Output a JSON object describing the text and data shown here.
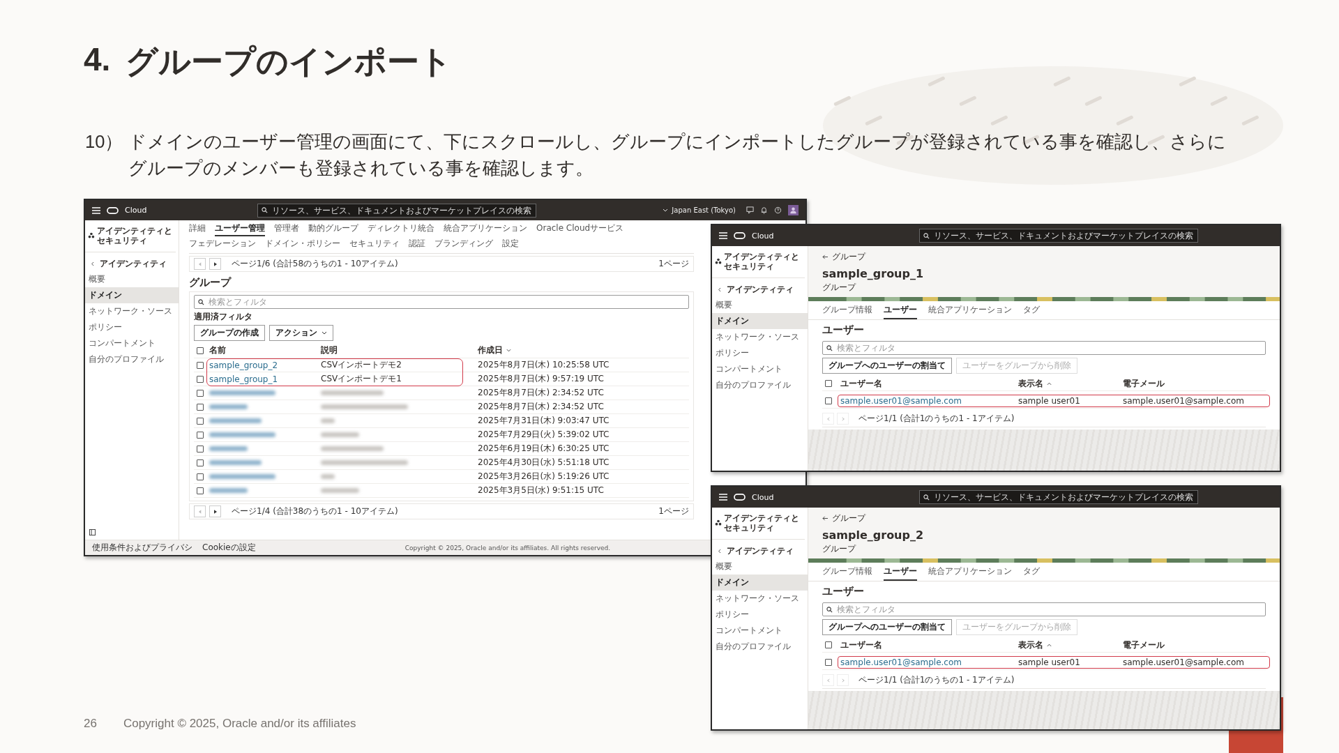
{
  "slide": {
    "title_number": "4.",
    "title": "グループのインポート",
    "step_number": "10）",
    "instruction": "ドメインのユーザー管理の画面にて、下にスクロールし、グループにインポートしたグループが登録されている事を確認し、さらにグループのメンバーも登録されている事を確認します。",
    "page_number": "26",
    "copyright": "Copyright © 2025, Oracle and/or its affiliates"
  },
  "console": {
    "brand": "Cloud",
    "search_placeholder": "リソース、サービス、ドキュメントおよびマーケットプレイスの検索",
    "region": "Japan East (Tokyo)",
    "sidebar": {
      "title": "アイデンティティとセキュリティ",
      "back": "アイデンティティ",
      "items": [
        {
          "label": "概要",
          "selected": false
        },
        {
          "label": "ドメイン",
          "selected": true
        },
        {
          "label": "ネットワーク・ソース",
          "selected": false
        },
        {
          "label": "ポリシー",
          "selected": false
        },
        {
          "label": "コンパートメント",
          "selected": false
        },
        {
          "label": "自分のプロファイル",
          "selected": false
        }
      ]
    },
    "tabs": [
      {
        "label": "詳細",
        "selected": false
      },
      {
        "label": "ユーザー管理",
        "selected": true
      },
      {
        "label": "管理者",
        "selected": false
      },
      {
        "label": "動的グループ",
        "selected": false
      },
      {
        "label": "ディレクトリ統合",
        "selected": false
      },
      {
        "label": "統合アプリケーション",
        "selected": false
      },
      {
        "label": "Oracle Cloudサービス",
        "selected": false
      },
      {
        "label": "フェデレーション",
        "selected": false
      },
      {
        "label": "ドメイン・ポリシー",
        "selected": false
      },
      {
        "label": "セキュリティ",
        "selected": false
      },
      {
        "label": "認証",
        "selected": false
      },
      {
        "label": "ブランディング",
        "selected": false
      },
      {
        "label": "設定",
        "selected": false
      }
    ],
    "pager_top": "ページ1/6 (合計58のうちの1 - 10アイテム)",
    "pager_top_right": "1ページ",
    "heading": "グループ",
    "filter_placeholder": "検索とフィルタ",
    "filter_label": "適用済フィルタ",
    "create_button": "グループの作成",
    "action_menu": "アクション",
    "columns": [
      "名前",
      "説明",
      "作成日"
    ],
    "header_checked": false,
    "rows": [
      {
        "kind": "group",
        "name": "sample_group_2",
        "description": "CSVインポートデモ2",
        "created": "2025年8月7日(木) 10:25:58 UTC",
        "highlighted": true,
        "checked": false
      },
      {
        "kind": "group",
        "name": "sample_group_1",
        "description": "CSVインポートデモ1",
        "created": "2025年8月7日(木) 9:57:19 UTC",
        "highlighted": true,
        "checked": false
      },
      {
        "kind": "blurred",
        "created": "2025年8月7日(木) 2:34:52 UTC",
        "highlighted": false,
        "checked": false
      },
      {
        "kind": "blurred",
        "created": "2025年8月7日(木) 2:34:52 UTC",
        "highlighted": false,
        "checked": false
      },
      {
        "kind": "blurred",
        "created": "2025年7月31日(木) 9:03:47 UTC",
        "highlighted": false,
        "checked": false
      },
      {
        "kind": "blurred",
        "created": "2025年7月29日(火) 5:39:02 UTC",
        "highlighted": false,
        "checked": false
      },
      {
        "kind": "blurred",
        "created": "2025年6月19日(木) 6:30:25 UTC",
        "highlighted": false,
        "checked": false
      },
      {
        "kind": "blurred",
        "created": "2025年4月30日(水) 5:51:18 UTC",
        "highlighted": false,
        "checked": false
      },
      {
        "kind": "blurred",
        "created": "2025年3月26日(水) 5:19:26 UTC",
        "highlighted": false,
        "checked": false
      },
      {
        "kind": "blurred",
        "created": "2025年3月5日(水) 9:51:15 UTC",
        "highlighted": false,
        "checked": false
      }
    ],
    "pager_bottom": "ページ1/4 (合計38のうちの1 - 10アイテム)",
    "pager_bottom_right": "1ページ",
    "footer_links": [
      "使用条件およびプライバシ",
      "Cookieの設定"
    ],
    "footer_copyright": "Copyright © 2025, Oracle and/or its affiliates. All rights reserved."
  },
  "group_windows": [
    {
      "brand": "Cloud",
      "search_placeholder": "リソース、サービス、ドキュメントおよびマーケットプレイスの検索",
      "sidebar": {
        "title": "アイデンティティとセキュリティ",
        "back": "アイデンティティ",
        "items": [
          {
            "label": "概要",
            "selected": false
          },
          {
            "label": "ドメイン",
            "selected": true
          },
          {
            "label": "ネットワーク・ソース",
            "selected": false
          },
          {
            "label": "ポリシー",
            "selected": false
          },
          {
            "label": "コンパートメント",
            "selected": false
          },
          {
            "label": "自分のプロファイル",
            "selected": false
          }
        ]
      },
      "back_link": "グループ",
      "title": "sample_group_1",
      "subtitle": "グループ",
      "tabs": [
        {
          "label": "グループ情報",
          "selected": false
        },
        {
          "label": "ユーザー",
          "selected": true
        },
        {
          "label": "統合アプリケーション",
          "selected": false
        },
        {
          "label": "タグ",
          "selected": false
        }
      ],
      "heading": "ユーザー",
      "filter_placeholder": "検索とフィルタ",
      "buttons": [
        {
          "label": "グループへのユーザーの割当て",
          "disabled": false
        },
        {
          "label": "ユーザーをグループから削除",
          "disabled": true
        }
      ],
      "columns": [
        "ユーザー名",
        "表示名",
        "電子メール"
      ],
      "header_checked": false,
      "rows": [
        {
          "username": "sample.user01@sample.com",
          "display_name": "sample user01",
          "email": "sample.user01@sample.com",
          "highlighted": true,
          "checked": false
        }
      ],
      "pager": "ページ1/1 (合計1のうちの1 - 1アイテム)"
    },
    {
      "brand": "Cloud",
      "search_placeholder": "リソース、サービス、ドキュメントおよびマーケットプレイスの検索",
      "sidebar": {
        "title": "アイデンティティとセキュリティ",
        "back": "アイデンティティ",
        "items": [
          {
            "label": "概要",
            "selected": false
          },
          {
            "label": "ドメイン",
            "selected": true
          },
          {
            "label": "ネットワーク・ソース",
            "selected": false
          },
          {
            "label": "ポリシー",
            "selected": false
          },
          {
            "label": "コンパートメント",
            "selected": false
          },
          {
            "label": "自分のプロファイル",
            "selected": false
          }
        ]
      },
      "back_link": "グループ",
      "title": "sample_group_2",
      "subtitle": "グループ",
      "tabs": [
        {
          "label": "グループ情報",
          "selected": false
        },
        {
          "label": "ユーザー",
          "selected": true
        },
        {
          "label": "統合アプリケーション",
          "selected": false
        },
        {
          "label": "タグ",
          "selected": false
        }
      ],
      "heading": "ユーザー",
      "filter_placeholder": "検索とフィルタ",
      "buttons": [
        {
          "label": "グループへのユーザーの割当て",
          "disabled": false
        },
        {
          "label": "ユーザーをグループから削除",
          "disabled": true
        }
      ],
      "columns": [
        "ユーザー名",
        "表示名",
        "電子メール"
      ],
      "header_checked": false,
      "rows": [
        {
          "username": "sample.user01@sample.com",
          "display_name": "sample user01",
          "email": "sample.user01@sample.com",
          "highlighted": true,
          "checked": false
        }
      ],
      "pager": "ページ1/1 (合計1のうちの1 - 1アイテム)"
    }
  ]
}
